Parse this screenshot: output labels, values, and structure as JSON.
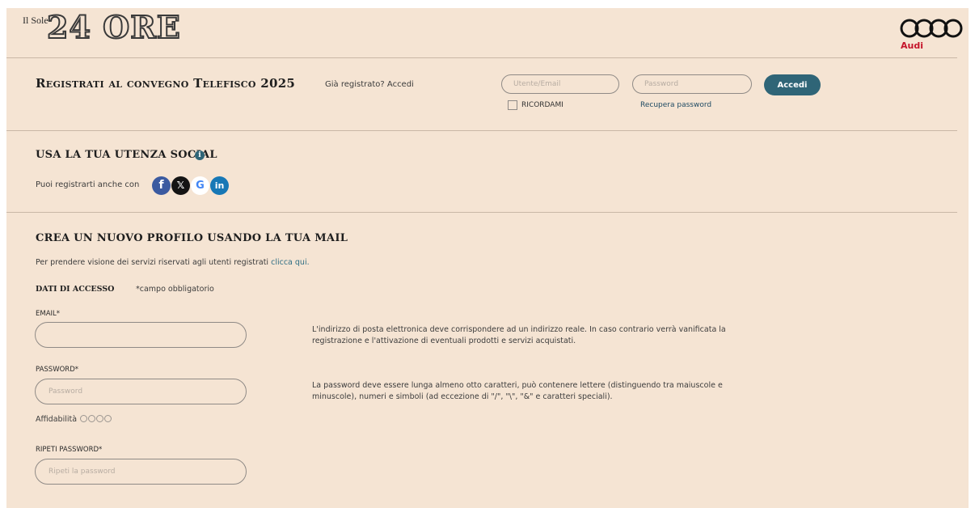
{
  "header": {
    "brand_small": "Il Sole",
    "brand_big": "24 ORE",
    "sponsor_icon": "audi-rings-icon",
    "sponsor_label": "Audi",
    "sponsor_color": "#c5152b"
  },
  "login": {
    "title": "Registrati al convegno Telefisco 2025",
    "already_registered": "Già registrato? Accedi",
    "user_placeholder": "Utente/Email",
    "password_placeholder": "Password",
    "submit_label": "Accedi",
    "remember_label": "RICORDAMI",
    "remember_checked": false,
    "recover_label": "Recupera password",
    "accent_color": "#2f6577"
  },
  "social": {
    "title": "USA LA TUA UTENZA SOCIAL",
    "info_icon": "info-icon",
    "intro": "Puoi registrarti anche con",
    "providers": [
      {
        "name": "facebook",
        "glyph": "f",
        "color": "#3b5aa0"
      },
      {
        "name": "x",
        "glyph": "𝕏",
        "color": "#141414"
      },
      {
        "name": "google",
        "glyph": "G",
        "color": "#4285f4"
      },
      {
        "name": "linkedin",
        "glyph": "in",
        "color": "#1778b6"
      }
    ]
  },
  "new_profile": {
    "title": "CREA UN NUOVO PROFILO USANDO LA TUA MAIL",
    "intro_text": "Per prendere visione dei servizi riservati agli utenti registrati ",
    "intro_link": "clicca qui.",
    "access_label": "DATI DI ACCESSO",
    "required_note": "*campo obbligatorio",
    "email_label": "EMAIL*",
    "email_value": "",
    "email_note": "L'indirizzo di posta elettronica deve corrispondere ad un indirizzo reale. In caso contrario verrà vanificata la registrazione e l'attivazione di eventuali prodotti e servizi acquistati.",
    "password_label": "PASSWORD*",
    "password_placeholder": "Password",
    "password_note": "La password deve essere lunga almeno otto caratteri, può contenere lettere (distinguendo tra maiuscole e minuscole), numeri e simboli (ad eccezione di \"/\", \"\\\", \"&\" e caratteri speciali).",
    "strength_label": "Affidabilità",
    "strength_level": 0,
    "strength_max": 4,
    "repeat_label": "RIPETI PASSWORD*",
    "repeat_placeholder": "Ripeti la password"
  }
}
